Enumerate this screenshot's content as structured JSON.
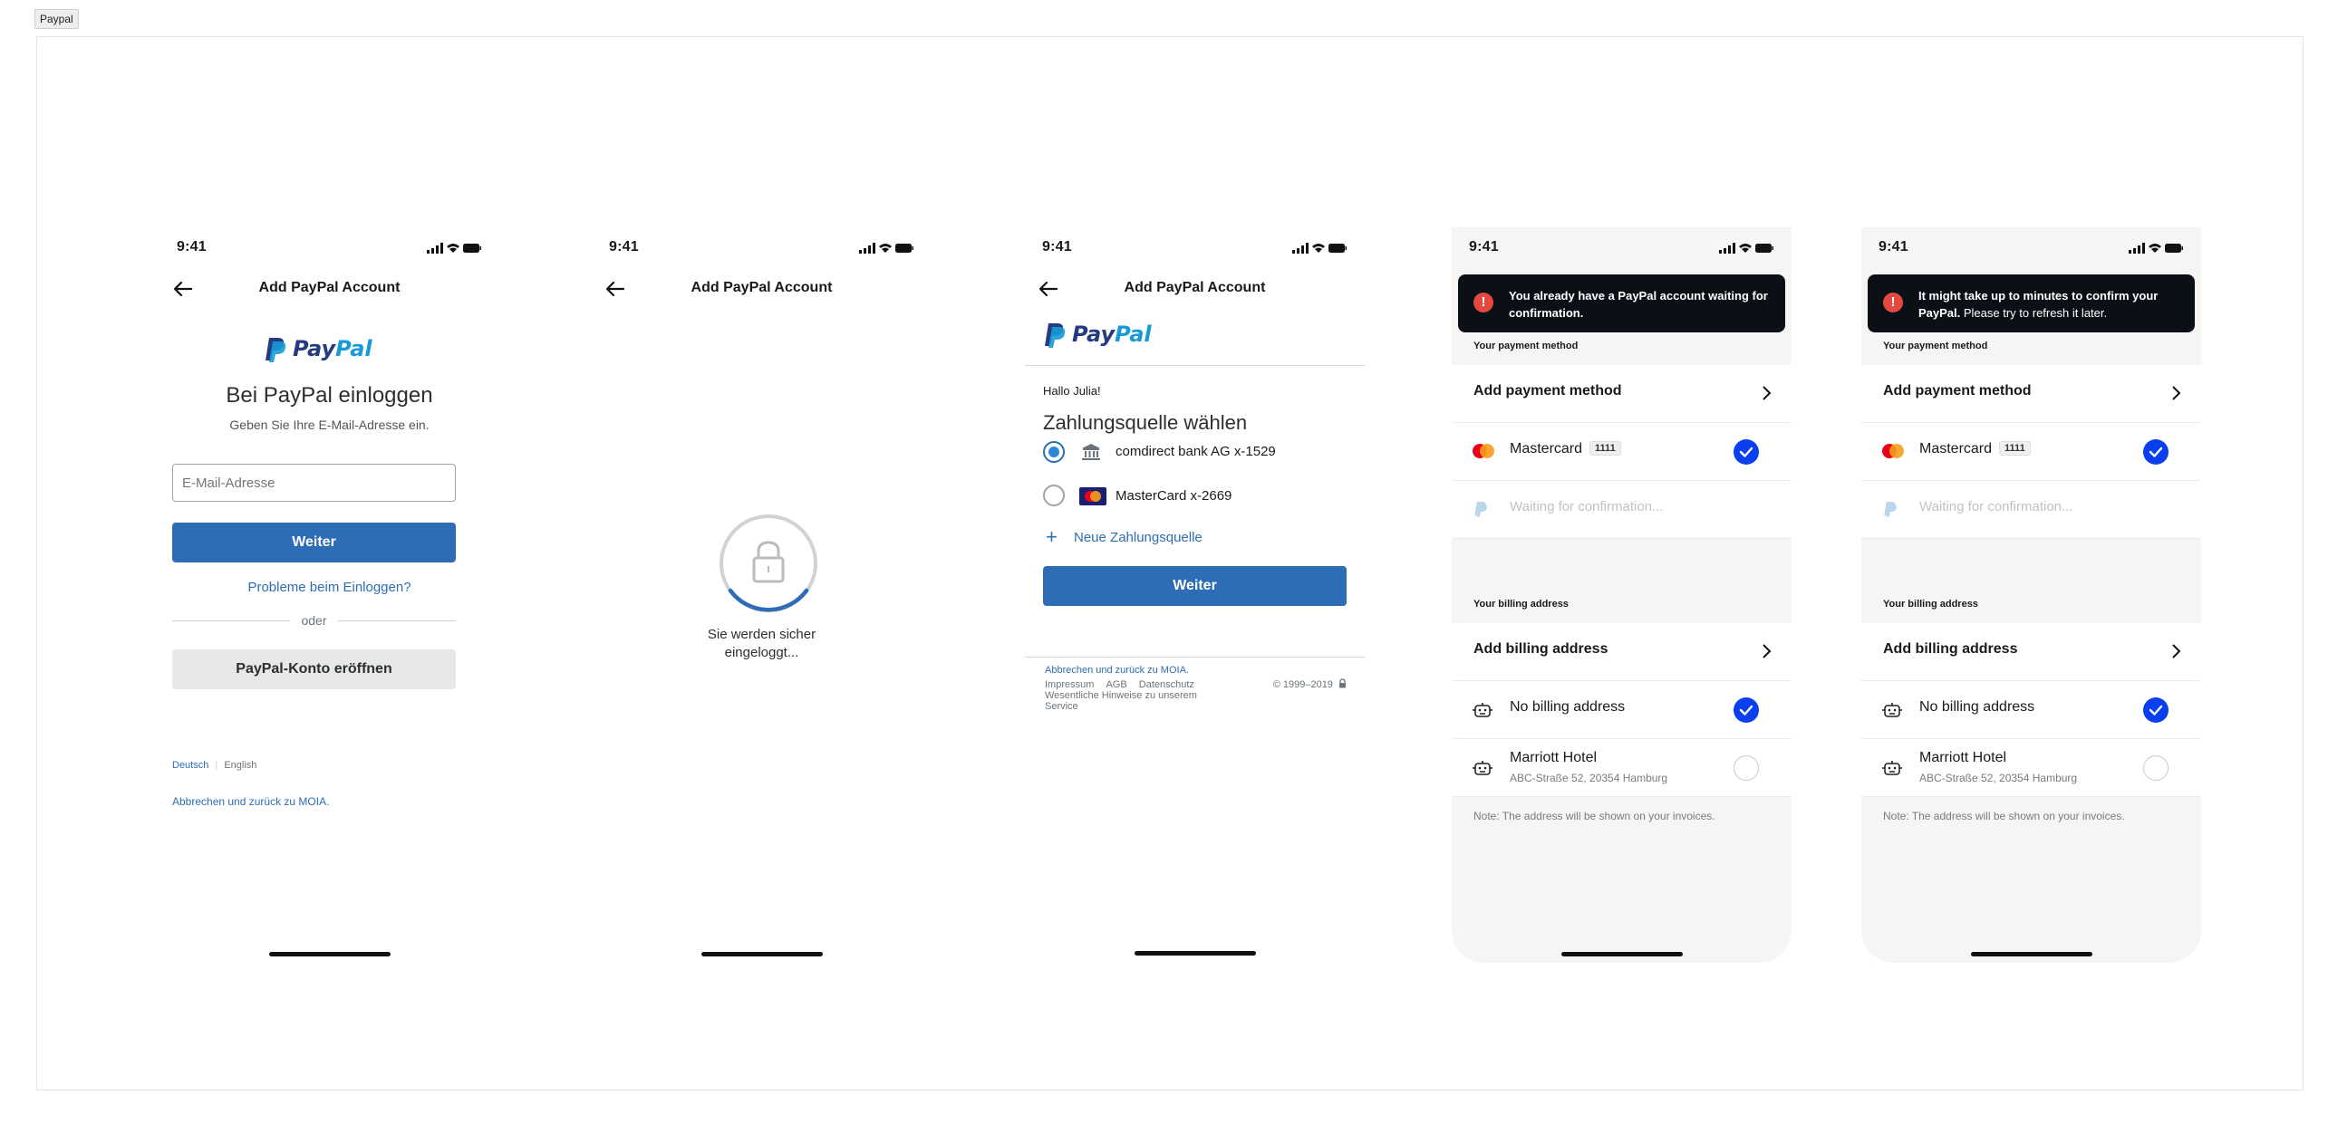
{
  "canvas": {
    "label": "Paypal"
  },
  "common": {
    "time": "9:41",
    "screen_title": "Add PayPal Account"
  },
  "paypal_logo": {
    "word1": "Pay",
    "word2": "Pal",
    "brand_dark": "#253b80",
    "brand_light": "#179bd7"
  },
  "login": {
    "heading": "Bei PayPal einloggen",
    "subheading": "Geben Sie Ihre E-Mail-Adresse ein.",
    "email_placeholder": "E-Mail-Adresse",
    "next_button": "Weiter",
    "problems_link": "Probleme beim Einloggen?",
    "or_text": "oder",
    "open_account_button": "PayPal-Konto eröffnen",
    "lang_de": "Deutsch",
    "lang_en": "English",
    "cancel_link": "Abbrechen und zurück zu MOIA."
  },
  "loading": {
    "line1": "Sie werden sicher",
    "line2": "eingeloggt..."
  },
  "select_source": {
    "greeting": "Hallo Julia!",
    "heading": "Zahlungsquelle wählen",
    "options": [
      {
        "label": "comdirect bank AG x-1529",
        "selected": true,
        "icon": "bank-icon"
      },
      {
        "label": "MasterCard x-2669",
        "selected": false,
        "icon": "mastercard-icon"
      }
    ],
    "add_source": "Neue Zahlungsquelle",
    "next_button": "Weiter",
    "cancel_link": "Abbrechen und zurück zu MOIA.",
    "footer_links": [
      "Impressum",
      "AGB",
      "Datenschutz"
    ],
    "footer_more": "Wesentliche Hinweise zu unserem",
    "footer_more2": "Service",
    "copyright": "© 1999–2019"
  },
  "wallet_screens": [
    {
      "toast_bold": "You already have a PayPal account waiting for confirmation.",
      "toast_rest": ""
    },
    {
      "toast_bold": "It might take up to minutes to confirm your PayPal.",
      "toast_rest": " Please try to refresh it later."
    }
  ],
  "wallet": {
    "payment_section": "Your payment method",
    "add_payment": "Add payment method",
    "card_name": "Mastercard",
    "card_last4": "1111",
    "waiting": "Waiting for confirmation...",
    "billing_section": "Your billing address",
    "add_billing": "Add billing address",
    "no_billing": "No billing address",
    "hotel_name": "Marriott Hotel",
    "hotel_address": "ABC-Straße 52, 20354 Hamburg",
    "note": "Note: The address will be shown on your invoices.",
    "accent": "#0a3ff0",
    "error": "#e5483f"
  }
}
